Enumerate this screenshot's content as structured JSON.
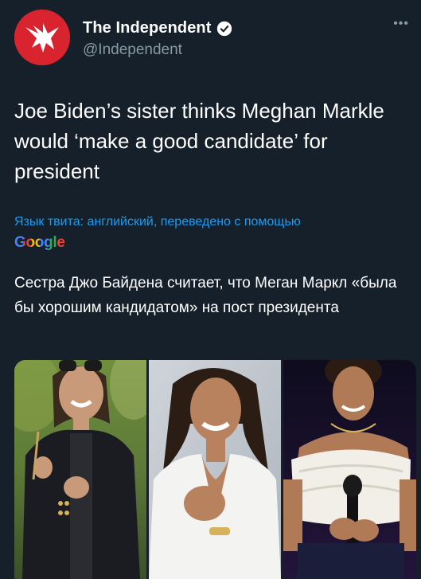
{
  "account": {
    "name": "The Independent",
    "handle": "@Independent",
    "verified": true,
    "avatar_icon": "eagle-logo-icon",
    "avatar_color": "#d9232e"
  },
  "tweet": {
    "text": "Joe Biden’s sister thinks Meghan Markle would ‘make a good candidate’ for president",
    "translation_notice": "Язык твита: английский, переведено с помощью",
    "translation_provider": "Google",
    "translated_text": "Сестра Джо Байдена считает, что Меган Маркл «была бы хорошим кандидатом» на пост президента"
  },
  "media": {
    "count": 3
  },
  "colors": {
    "background": "#15202b",
    "link": "#1d9bf0",
    "secondary_text": "#8899a6"
  }
}
